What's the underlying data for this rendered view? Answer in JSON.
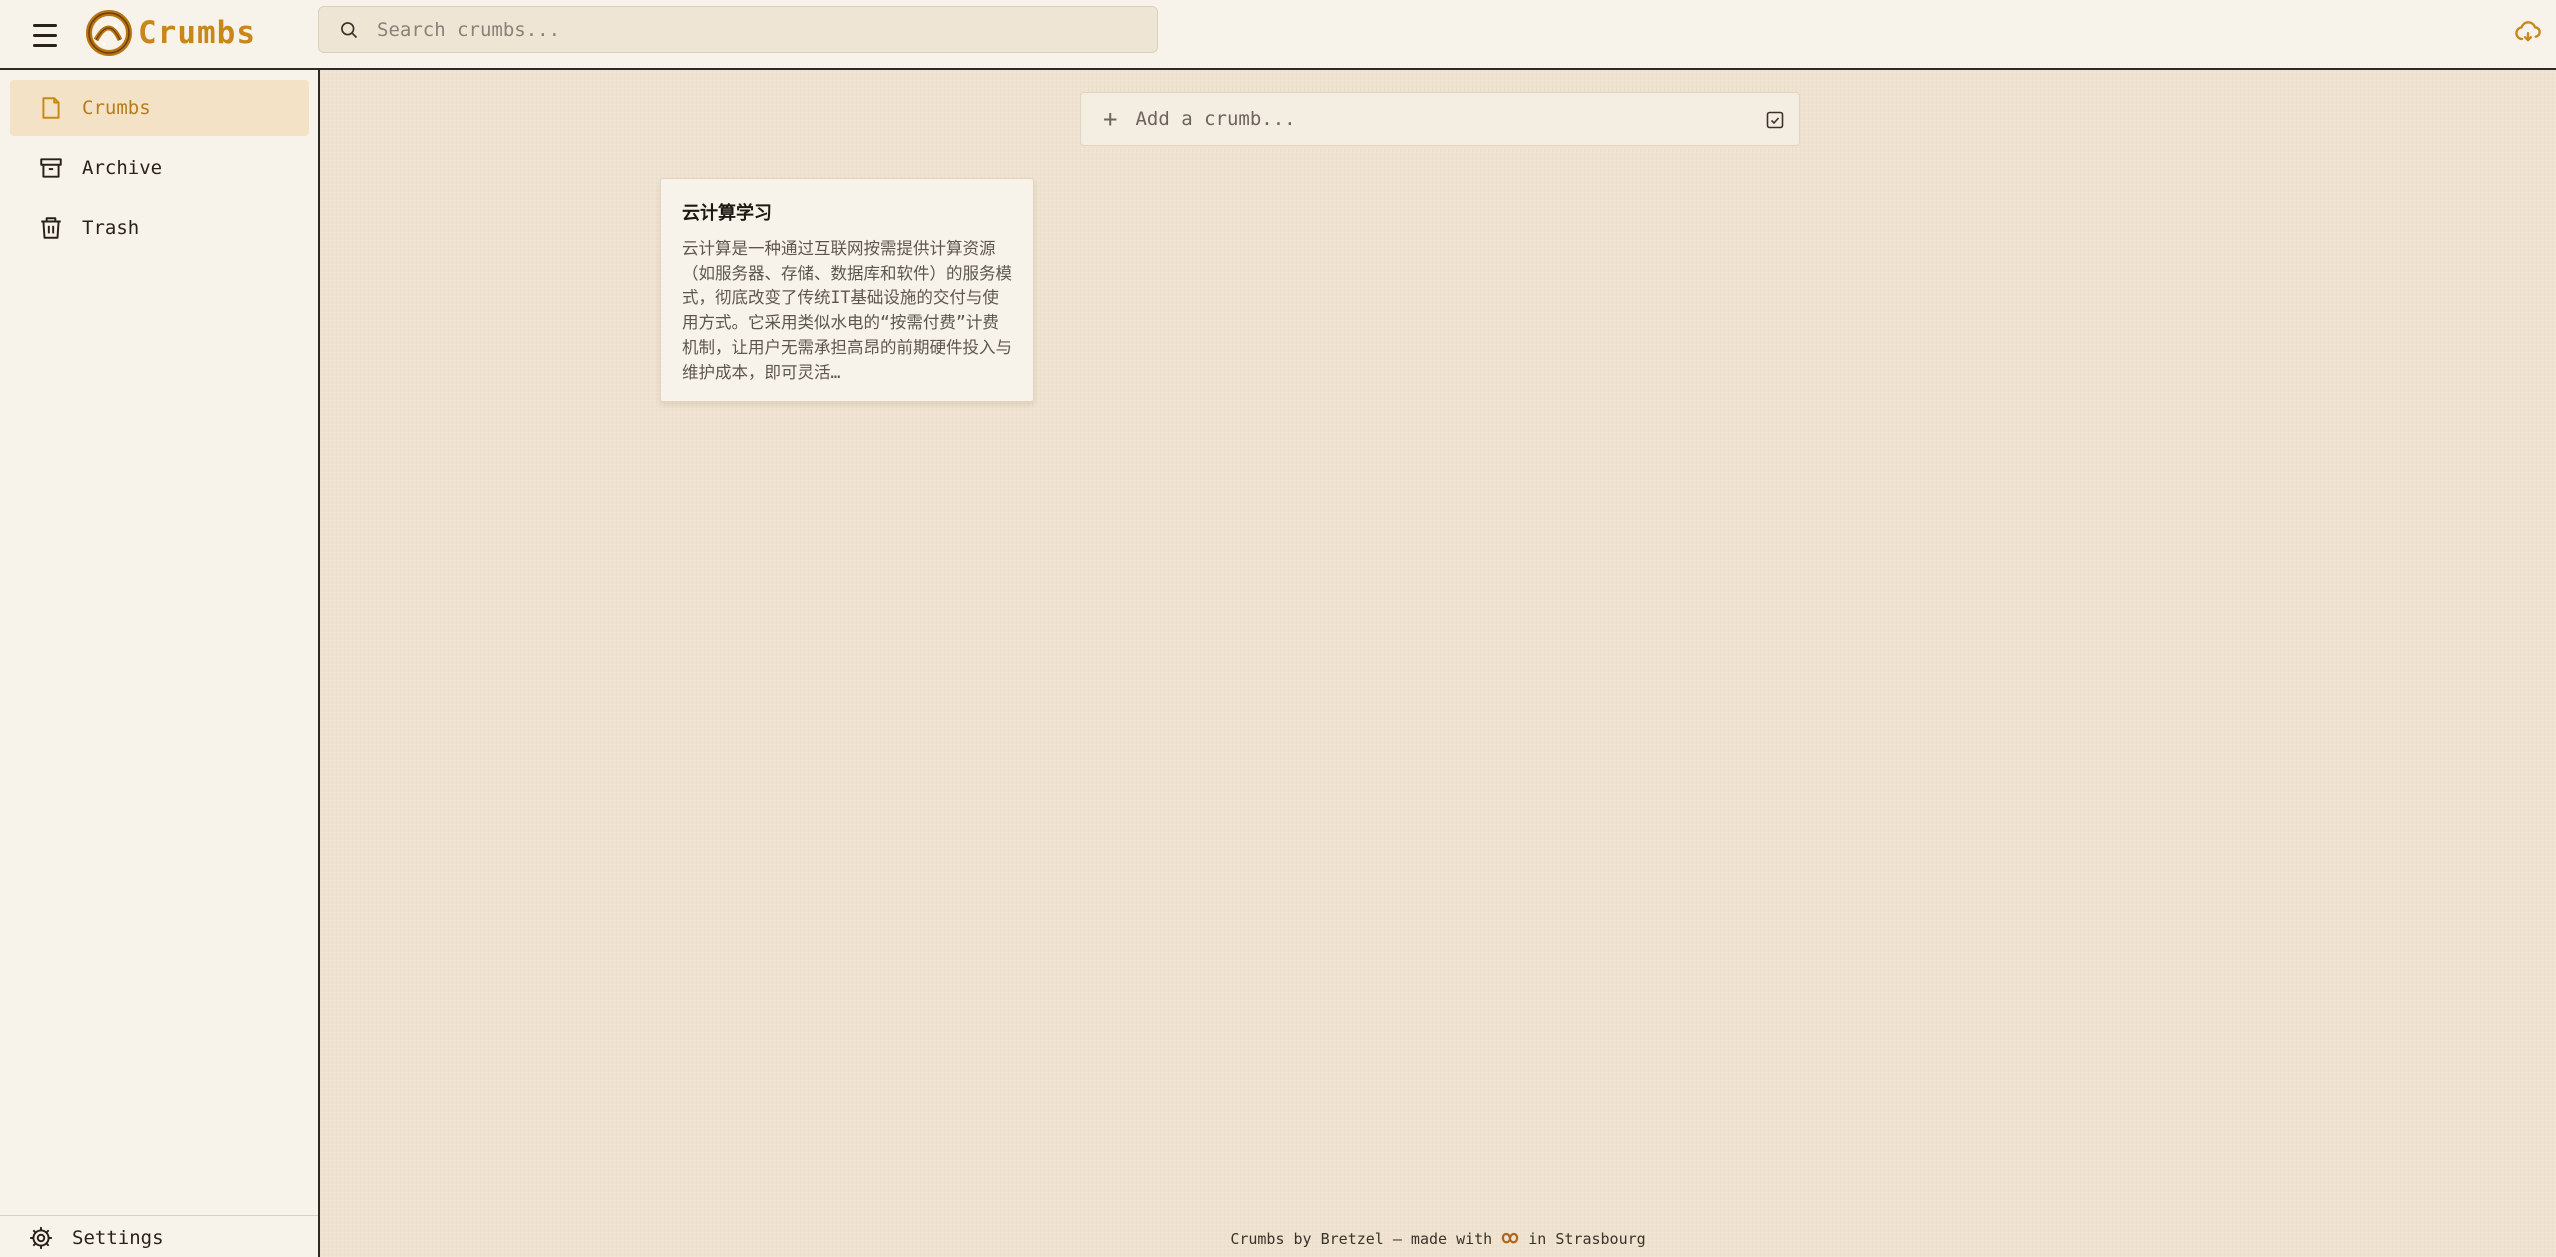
{
  "app": {
    "name": "Crumbs"
  },
  "search": {
    "placeholder": "Search crumbs..."
  },
  "sidebar": {
    "items": [
      {
        "label": "Crumbs",
        "icon": "note-icon",
        "active": true
      },
      {
        "label": "Archive",
        "icon": "archive-icon",
        "active": false
      },
      {
        "label": "Trash",
        "icon": "trash-icon",
        "active": false
      }
    ],
    "settings_label": "Settings"
  },
  "composer": {
    "placeholder": "Add a crumb..."
  },
  "notes": [
    {
      "title": "云计算学习",
      "body": "云计算是一种通过互联网按需提供计算资源（如服务器、存储、数据库和软件）的服务模式，彻底改变了传统IT基础设施的交付与使用方式。它采用类似水电的“按需付费”计费机制，让用户无需承担高昂的前期硬件投入与维护成本，即可灵活…"
    }
  ],
  "footer": {
    "before": "Crumbs by Bretzel — made with",
    "after": "in Strasbourg"
  },
  "colors": {
    "accent": "#c9871a",
    "active_bg": "#f3e2c6",
    "border": "#2e2a26",
    "main_bg": "#efe3d0"
  }
}
